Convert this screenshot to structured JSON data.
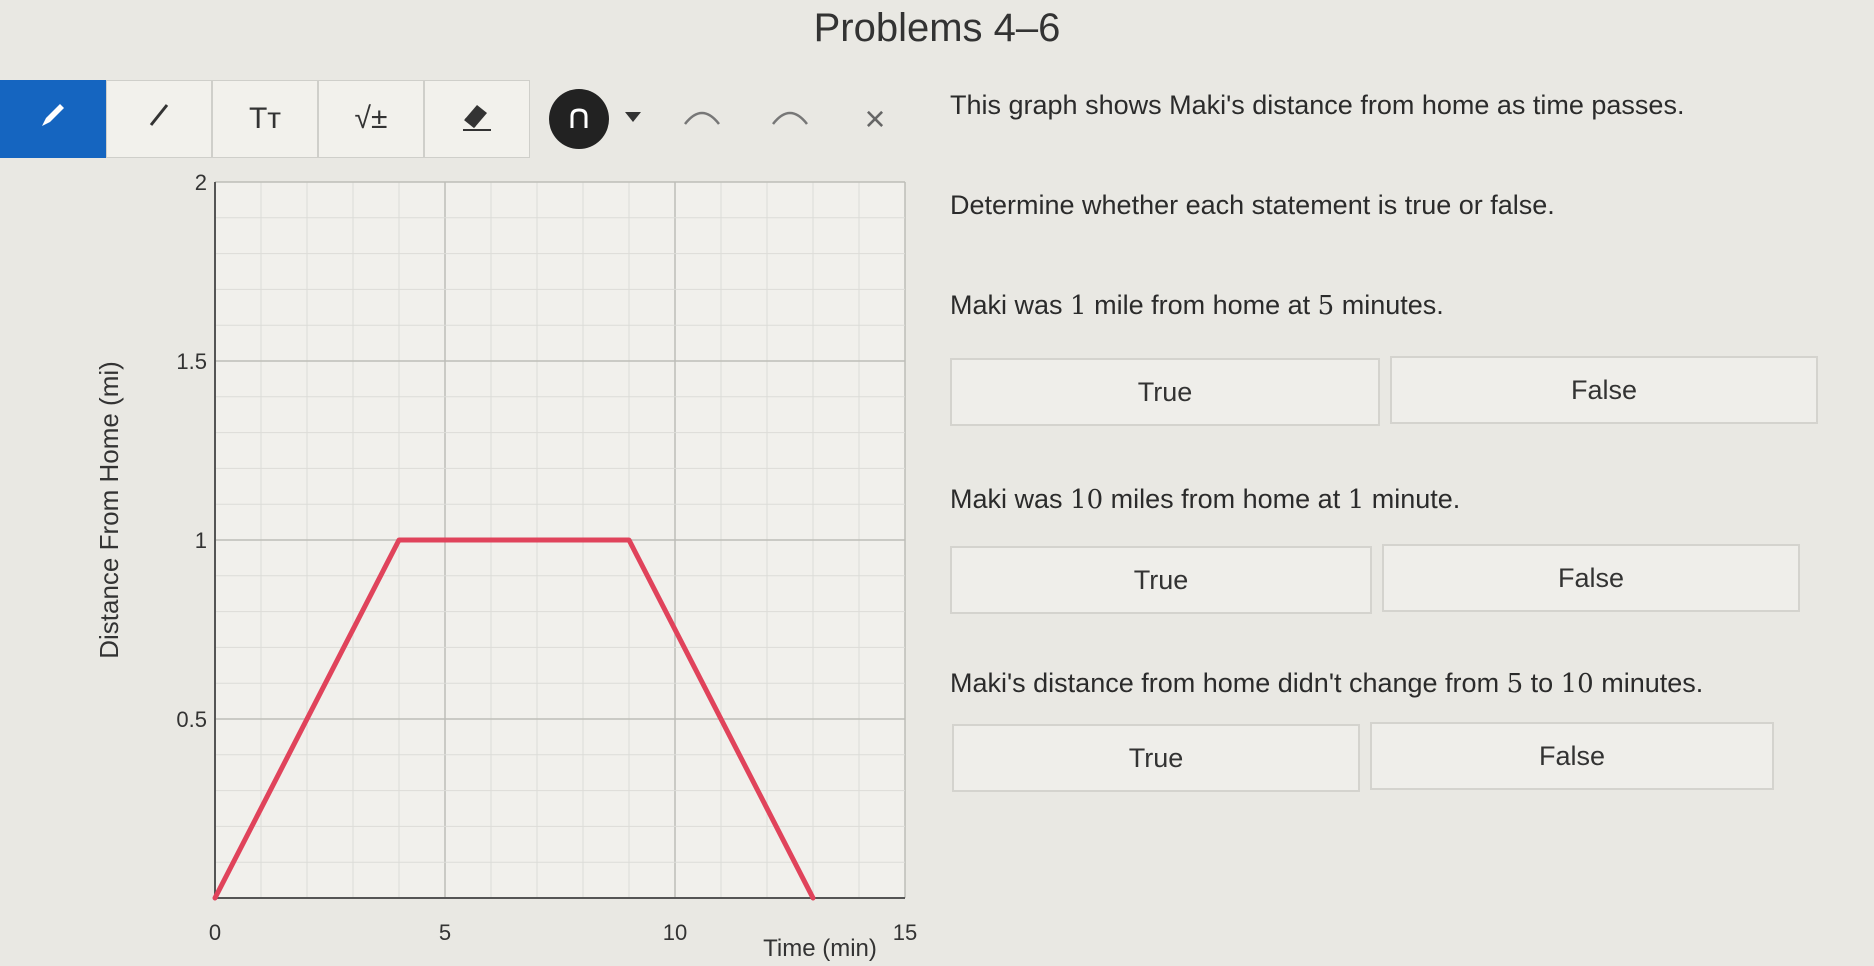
{
  "header": {
    "title": "Problems 4–6"
  },
  "toolbar": {
    "tools": [
      {
        "icon": "pencil-icon",
        "active": true
      },
      {
        "icon": "line-icon"
      },
      {
        "icon": "text-size-icon",
        "label": "Tт"
      },
      {
        "icon": "math-symbol-icon",
        "label": "√±"
      },
      {
        "icon": "eraser-icon"
      },
      {
        "icon": "curve-pen-icon"
      },
      {
        "icon": "dropdown-icon"
      },
      {
        "icon": "undo-icon"
      },
      {
        "icon": "redo-icon"
      },
      {
        "icon": "close-icon",
        "label": "×"
      }
    ],
    "accent_color": "#1565c0"
  },
  "panel": {
    "intro": "This graph shows Maki's distance from home as time passes.",
    "instruction": "Determine whether each statement is true or false.",
    "statements": [
      {
        "prefix": "Maki was ",
        "n1": "1",
        "mid": " mile from home at ",
        "n2": "5",
        "suffix": " minutes.",
        "true_label": "True",
        "false_label": "False"
      },
      {
        "prefix": "Maki was ",
        "n1": "10",
        "mid": " miles from home at ",
        "n2": "1",
        "suffix": " minute.",
        "true_label": "True",
        "false_label": "False"
      },
      {
        "prefix": "Maki's distance from home didn't change from ",
        "n1": "5",
        "mid": " to ",
        "n2": "10",
        "suffix": " minutes.",
        "true_label": "True",
        "false_label": "False"
      }
    ]
  },
  "chart_data": {
    "type": "line",
    "xlabel": "Time (min)",
    "ylabel": "Distance From Home (mi)",
    "xlim": [
      0,
      15
    ],
    "ylim": [
      0,
      2
    ],
    "x_ticks": [
      "0",
      "5",
      "10",
      "15"
    ],
    "y_ticks": [
      "0.5",
      "1",
      "1.5",
      "2"
    ],
    "grid": true,
    "series": [
      {
        "x": [
          0,
          4,
          9,
          13
        ],
        "y": [
          0,
          1,
          1,
          0
        ],
        "color": "#e0435b"
      }
    ]
  }
}
